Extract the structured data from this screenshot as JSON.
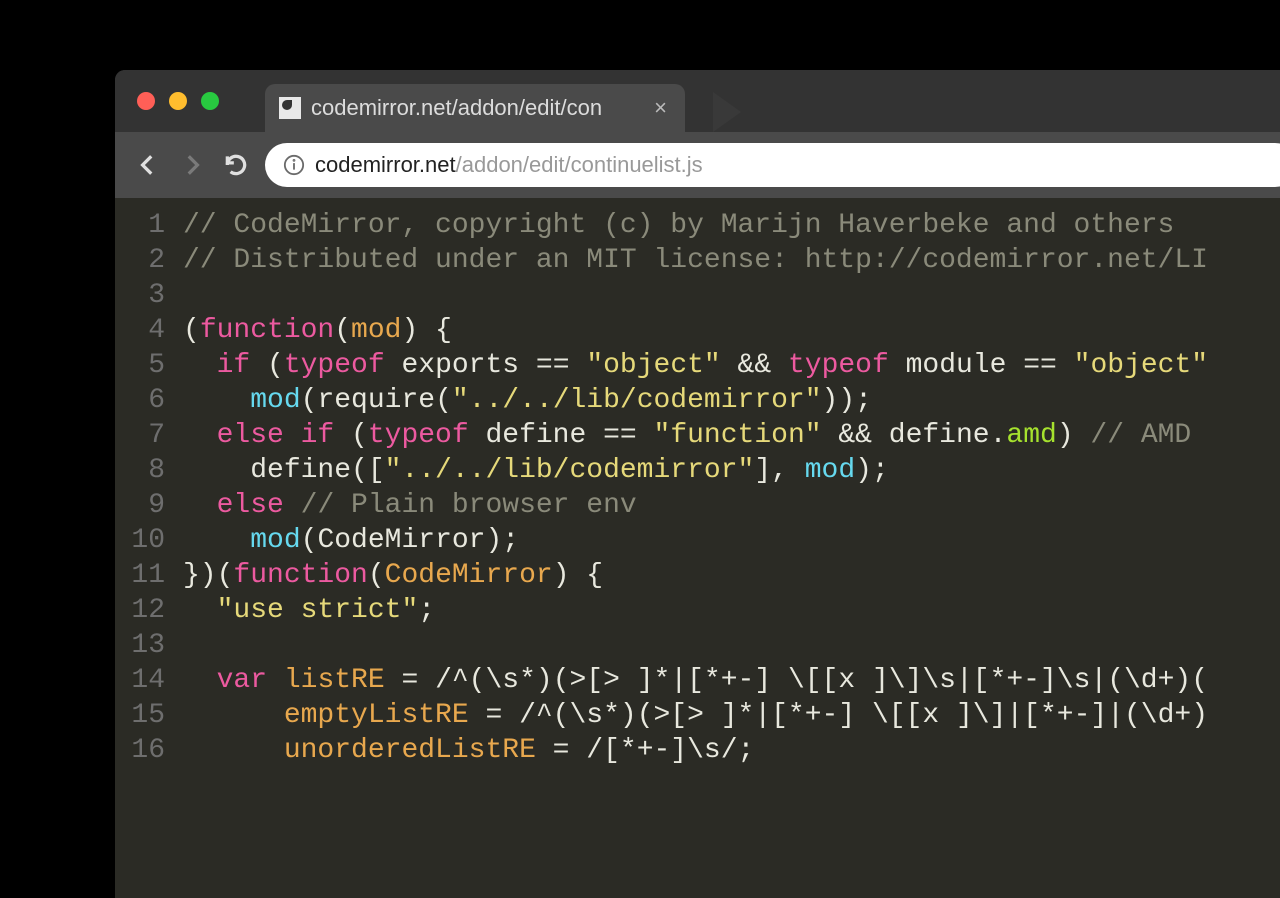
{
  "browser": {
    "tab_title": "codemirror.net/addon/edit/con",
    "url_host": "codemirror.net",
    "url_path": "/addon/edit/continuelist.js"
  },
  "editor": {
    "line_numbers": [
      "1",
      "2",
      "3",
      "4",
      "5",
      "6",
      "7",
      "8",
      "9",
      "10",
      "11",
      "12",
      "13",
      "14",
      "15",
      "16"
    ],
    "lines": [
      [
        {
          "c": "tok-comment",
          "t": "// CodeMirror, copyright (c) by Marijn Haverbeke and others"
        }
      ],
      [
        {
          "c": "tok-comment",
          "t": "// Distributed under an MIT license: http://codemirror.net/LI"
        }
      ],
      [],
      [
        {
          "c": "tok-punct",
          "t": "("
        },
        {
          "c": "tok-keyword",
          "t": "function"
        },
        {
          "c": "tok-punct",
          "t": "("
        },
        {
          "c": "tok-def",
          "t": "mod"
        },
        {
          "c": "tok-punct",
          "t": ") {"
        }
      ],
      [
        {
          "c": "",
          "t": "  "
        },
        {
          "c": "tok-keyword",
          "t": "if"
        },
        {
          "c": "",
          "t": " ("
        },
        {
          "c": "tok-keyword",
          "t": "typeof"
        },
        {
          "c": "",
          "t": " exports "
        },
        {
          "c": "tok-op",
          "t": "=="
        },
        {
          "c": "",
          "t": " "
        },
        {
          "c": "tok-string",
          "t": "\"object\""
        },
        {
          "c": "",
          "t": " "
        },
        {
          "c": "tok-op",
          "t": "&&"
        },
        {
          "c": "",
          "t": " "
        },
        {
          "c": "tok-keyword",
          "t": "typeof"
        },
        {
          "c": "",
          "t": " module "
        },
        {
          "c": "tok-op",
          "t": "=="
        },
        {
          "c": "",
          "t": " "
        },
        {
          "c": "tok-string",
          "t": "\"object\""
        }
      ],
      [
        {
          "c": "",
          "t": "    "
        },
        {
          "c": "tok-var",
          "t": "mod"
        },
        {
          "c": "",
          "t": "(require("
        },
        {
          "c": "tok-string",
          "t": "\"../../lib/codemirror\""
        },
        {
          "c": "",
          "t": "));"
        }
      ],
      [
        {
          "c": "",
          "t": "  "
        },
        {
          "c": "tok-keyword",
          "t": "else if"
        },
        {
          "c": "",
          "t": " ("
        },
        {
          "c": "tok-keyword",
          "t": "typeof"
        },
        {
          "c": "",
          "t": " define "
        },
        {
          "c": "tok-op",
          "t": "=="
        },
        {
          "c": "",
          "t": " "
        },
        {
          "c": "tok-string",
          "t": "\"function\""
        },
        {
          "c": "",
          "t": " "
        },
        {
          "c": "tok-op",
          "t": "&&"
        },
        {
          "c": "",
          "t": " define."
        },
        {
          "c": "tok-prop",
          "t": "amd"
        },
        {
          "c": "",
          "t": ") "
        },
        {
          "c": "tok-comment",
          "t": "// AMD"
        }
      ],
      [
        {
          "c": "",
          "t": "    define(["
        },
        {
          "c": "tok-string",
          "t": "\"../../lib/codemirror\""
        },
        {
          "c": "",
          "t": "], "
        },
        {
          "c": "tok-var",
          "t": "mod"
        },
        {
          "c": "",
          "t": ");"
        }
      ],
      [
        {
          "c": "",
          "t": "  "
        },
        {
          "c": "tok-keyword",
          "t": "else"
        },
        {
          "c": "",
          "t": " "
        },
        {
          "c": "tok-comment",
          "t": "// Plain browser env"
        }
      ],
      [
        {
          "c": "",
          "t": "    "
        },
        {
          "c": "tok-var",
          "t": "mod"
        },
        {
          "c": "",
          "t": "(CodeMirror);"
        }
      ],
      [
        {
          "c": "",
          "t": "})("
        },
        {
          "c": "tok-keyword",
          "t": "function"
        },
        {
          "c": "",
          "t": "("
        },
        {
          "c": "tok-def",
          "t": "CodeMirror"
        },
        {
          "c": "",
          "t": ") {"
        }
      ],
      [
        {
          "c": "",
          "t": "  "
        },
        {
          "c": "tok-string",
          "t": "\"use strict\""
        },
        {
          "c": "",
          "t": ";"
        }
      ],
      [],
      [
        {
          "c": "",
          "t": "  "
        },
        {
          "c": "tok-keyword",
          "t": "var"
        },
        {
          "c": "",
          "t": " "
        },
        {
          "c": "tok-def",
          "t": "listRE"
        },
        {
          "c": "",
          "t": " = /^(\\s*)(>[> ]*|[*+-] \\[[x ]\\]\\s|[*+-]\\s|(\\d+)("
        }
      ],
      [
        {
          "c": "",
          "t": "      "
        },
        {
          "c": "tok-def",
          "t": "emptyListRE"
        },
        {
          "c": "",
          "t": " = /^(\\s*)(>[> ]*|[*+-] \\[[x ]\\]|[*+-]|(\\d+)"
        }
      ],
      [
        {
          "c": "",
          "t": "      "
        },
        {
          "c": "tok-def",
          "t": "unorderedListRE"
        },
        {
          "c": "",
          "t": " = /[*+-]\\s/;"
        }
      ]
    ]
  }
}
